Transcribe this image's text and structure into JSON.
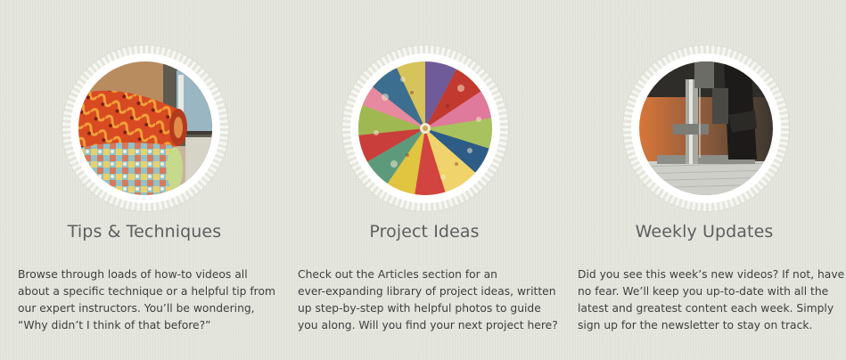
{
  "features": [
    {
      "title": "Tips & Techniques",
      "description_lines": [
        "Browse through loads of how-to videos all",
        "about a specific technique or a helpful tip from",
        "our expert instructors. You’ll be wondering,",
        "“Why didn’t I think of that before?”"
      ]
    },
    {
      "title": "Project Ideas",
      "description_lines": [
        "Check out the Articles section for an",
        "ever-expanding library of project ideas, written",
        "up step-by-step with helpful photos to guide",
        "you along. Will you find your next project here?"
      ]
    },
    {
      "title": "Weekly Updates",
      "description_lines": [
        "Did you see this week’s new videos? If not, have",
        "no fear. We’ll keep you up-to-date with all the",
        "latest and greatest content each week. Simply",
        "sign up for the newsletter to stay on track."
      ]
    }
  ],
  "colors": {
    "background": "#e4e5dd",
    "heading": "#5c5f5e",
    "body_text": "#3d3f3e"
  }
}
